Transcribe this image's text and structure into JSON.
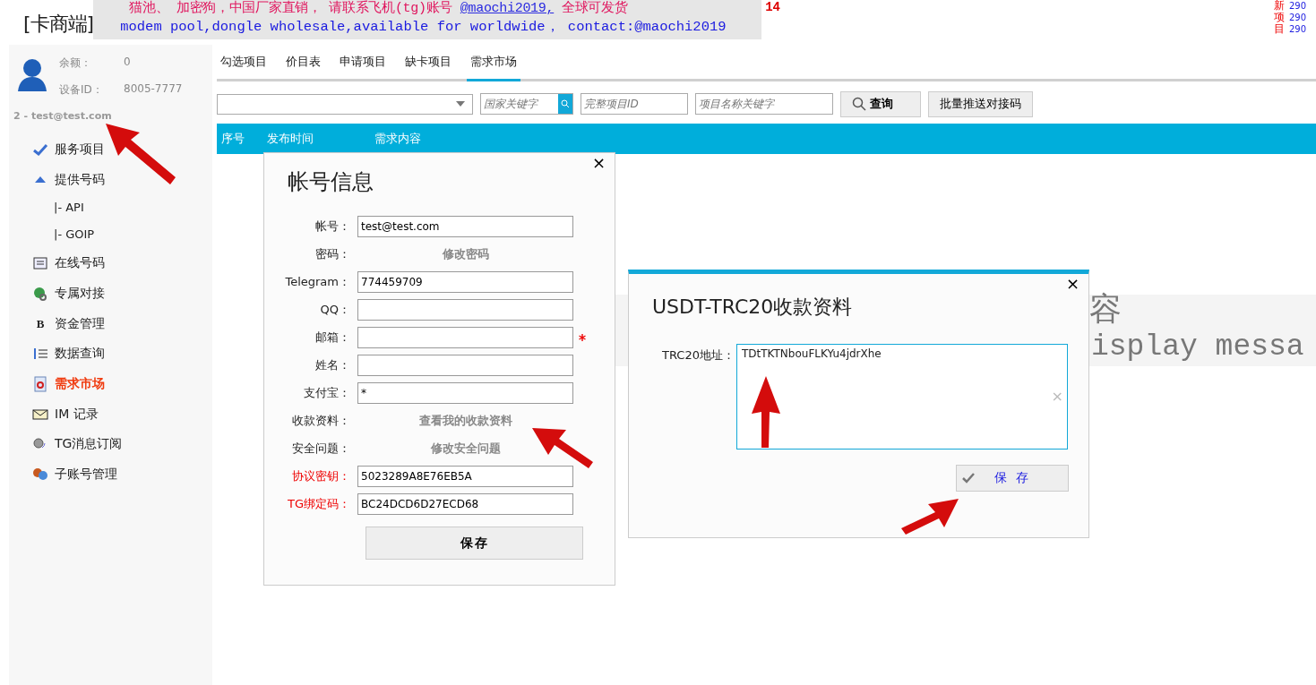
{
  "header": {
    "logo": "[卡商端]",
    "ad_line_1": "猫池、 加密狗，中国厂家直销， 请联系飞机(tg)账号 ",
    "ad_link": "@maochi2019,",
    "ad_line_1_end": " 全球可发货",
    "ad_line_2": "modem pool,dongle wholesale,available for worldwide， contact:@maochi2019",
    "badge": "14",
    "new_label": "新项目",
    "new_counts": [
      "290",
      "290",
      "290"
    ]
  },
  "profile": {
    "balance_label": "余额：",
    "balance": "0",
    "device_label": "设备ID：",
    "device_id": "8005-7777",
    "account": "2 - test@test.com"
  },
  "sidebar": {
    "items": [
      {
        "label": "服务项目",
        "selected": false
      },
      {
        "label": "提供号码",
        "selected": false,
        "children": [
          {
            "label": "|-  API"
          },
          {
            "label": "|-  GOIP"
          }
        ]
      },
      {
        "label": "在线号码",
        "selected": false
      },
      {
        "label": "专属对接",
        "selected": false
      },
      {
        "label": "资金管理",
        "glyph": "B",
        "selected": false
      },
      {
        "label": "数据查询",
        "selected": false
      },
      {
        "label": "需求市场",
        "selected": true
      },
      {
        "label": "IM 记录",
        "selected": false
      },
      {
        "label": "TG消息订阅",
        "selected": false
      },
      {
        "label": "子账号管理",
        "selected": false
      }
    ]
  },
  "tabs": [
    {
      "label": "勾选项目",
      "selected": false
    },
    {
      "label": "价目表",
      "selected": false
    },
    {
      "label": "申请项目",
      "selected": false
    },
    {
      "label": "缺卡项目",
      "selected": false
    },
    {
      "label": "需求市场",
      "selected": true
    }
  ],
  "toolbar": {
    "country_placeholder": "国家关键字",
    "project_id_placeholder": "完整项目ID",
    "project_name_placeholder": "项目名称关键字",
    "search_button": "查询",
    "push_button": "批量推送对接码"
  },
  "table": {
    "columns": [
      "序号",
      "发布时间",
      "需求内容"
    ]
  },
  "background_message": {
    "line_1": "容",
    "line_2": "isplay messa"
  },
  "account_dialog": {
    "title": "帐号信息",
    "rows": [
      {
        "kind": "input",
        "label": "帐号：",
        "value": "test@test.com",
        "required": false,
        "highlight": false
      },
      {
        "kind": "link",
        "label": "密码：",
        "value": "修改密码",
        "required": false,
        "highlight": false
      },
      {
        "kind": "input",
        "label": "Telegram：",
        "value": "774459709",
        "required": false,
        "highlight": false
      },
      {
        "kind": "input",
        "label": "QQ：",
        "required": false,
        "highlight": false
      },
      {
        "kind": "input",
        "label": "邮箱：",
        "required": true,
        "highlight": false
      },
      {
        "kind": "input",
        "label": "姓名：",
        "required": false,
        "highlight": false
      },
      {
        "kind": "input",
        "label": "支付宝：",
        "value": "*",
        "required": false,
        "highlight": false
      },
      {
        "kind": "link",
        "label": "收款资料：",
        "value": "查看我的收款资料",
        "required": false,
        "highlight": false
      },
      {
        "kind": "link",
        "label": "安全问题：",
        "value": "修改安全问题",
        "required": false,
        "highlight": false
      },
      {
        "kind": "input",
        "label": "协议密钥：",
        "value": "5023289A8E76EB5A",
        "required": false,
        "highlight": true
      },
      {
        "kind": "input",
        "label": "TG绑定码：",
        "value": "BC24DCD6D27ECD68",
        "required": false,
        "highlight": true
      }
    ],
    "save_button": "保存",
    "close": "×"
  },
  "trc_dialog": {
    "title_latin": "USDT-TRC20",
    "title_cn": "收款资料",
    "address_label": "TRC20地址：",
    "address": "TDtTKTNbouFLKYu4jdrXhe",
    "clear": "×",
    "save_button": "保 存",
    "close": "×"
  }
}
